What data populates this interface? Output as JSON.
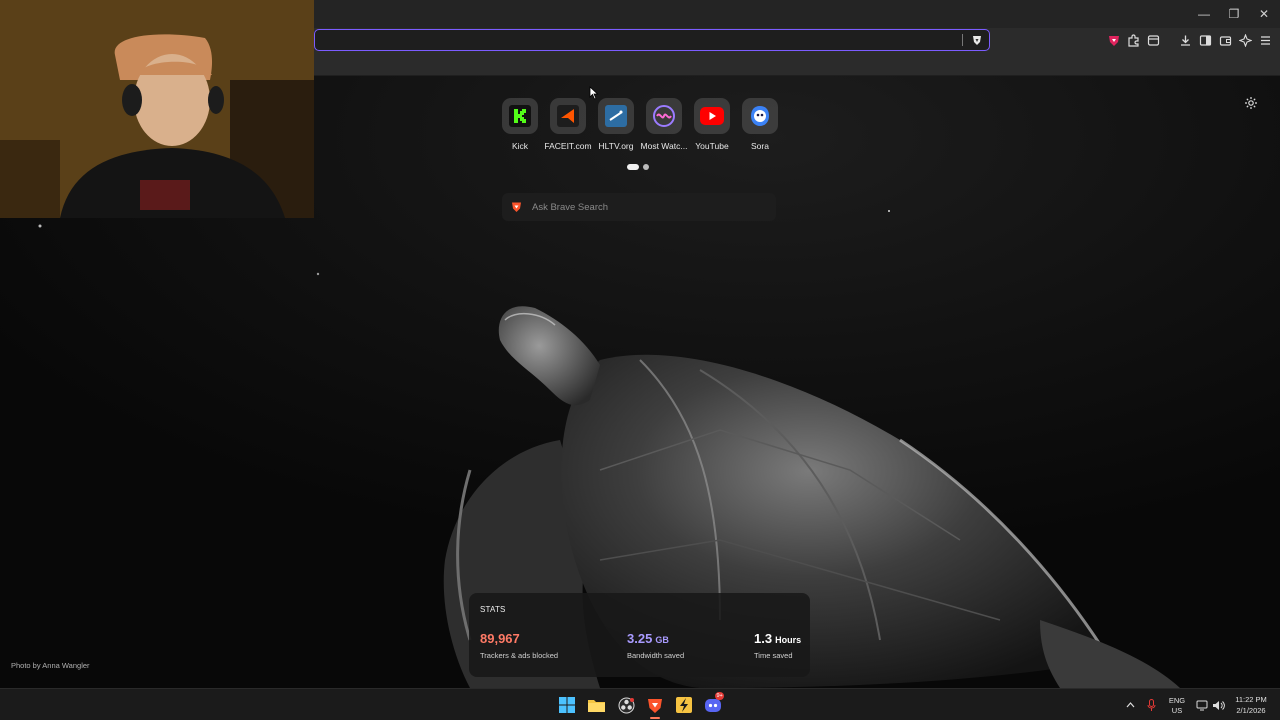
{
  "window": {
    "minimize_glyph": "—",
    "restore_glyph": "❐",
    "close_glyph": "✕"
  },
  "address_bar": {
    "value": "",
    "placeholder": ""
  },
  "toolbar_icons": [
    "brave-shields-icon",
    "extensions-icon",
    "tab-search-icon",
    "downloads-icon",
    "sidebar-icon",
    "wallet-icon",
    "leo-ai-icon",
    "menu-icon"
  ],
  "top_sites": [
    {
      "label": "Kick",
      "icon": "kick-icon",
      "color": "#53fc18"
    },
    {
      "label": "FACEIT.com",
      "icon": "faceit-icon",
      "color": "#ff5500"
    },
    {
      "label": "HLTV.org",
      "icon": "hltv-icon",
      "color": "#2d6da3"
    },
    {
      "label": "Most Watc...",
      "icon": "most-watched-icon",
      "color": "#9b7bff"
    },
    {
      "label": "YouTube",
      "icon": "youtube-icon",
      "color": "#ff0000"
    },
    {
      "label": "Sora",
      "icon": "sora-icon",
      "color": "#3b82f6"
    }
  ],
  "search": {
    "placeholder": "Ask Brave Search"
  },
  "stats": {
    "title": "STATS",
    "trackers": {
      "value": "89,967",
      "caption": "Trackers & ads blocked",
      "color": "#ff7a66"
    },
    "bandwidth": {
      "value": "3.25",
      "unit": "GB",
      "caption": "Bandwidth saved",
      "color": "#a99bff"
    },
    "time": {
      "value": "1.3",
      "unit": "Hours",
      "caption": "Time saved",
      "color": "#ffffff"
    }
  },
  "photo_credit": "Photo by Anna Wangler",
  "taskbar": {
    "apps": [
      "windows-start-icon",
      "file-explorer-icon",
      "obs-icon",
      "brave-browser-icon",
      "winamp-icon",
      "discord-icon"
    ],
    "discord_badge": "9+",
    "lang_top": "ENG",
    "lang_bottom": "US",
    "time": "11:22 PM",
    "date": "2/1/2026"
  }
}
